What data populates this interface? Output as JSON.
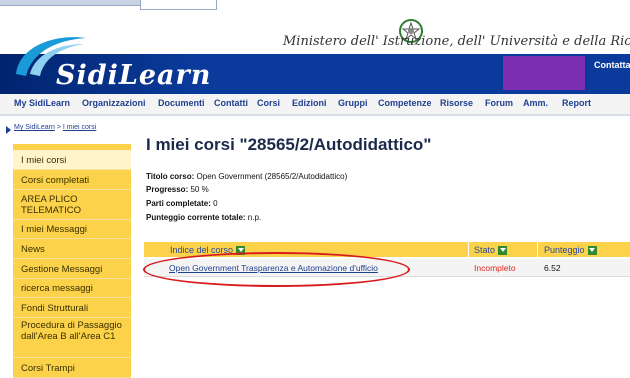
{
  "header": {
    "brand": "SidiLearn",
    "ministry": "Ministero dell' Istruzione, dell' Università e della Ricerca",
    "contact_label": "Contattaci",
    "brand_color": "#0a3b9c",
    "accent_purple": "#7b2fb0"
  },
  "nav": {
    "items": [
      {
        "label": "My SidiLearn"
      },
      {
        "label": "Organizzazioni"
      },
      {
        "label": "Documenti"
      },
      {
        "label": "Contatti"
      },
      {
        "label": "Corsi"
      },
      {
        "label": "Edizioni"
      },
      {
        "label": "Gruppi"
      },
      {
        "label": "Competenze"
      },
      {
        "label": "Risorse"
      },
      {
        "label": "Forum"
      },
      {
        "label": "Amm."
      },
      {
        "label": "Report"
      }
    ]
  },
  "breadcrumb": {
    "home": "My SidiLearn",
    "sep": ">",
    "current": "I miei corsi"
  },
  "sidebar": {
    "items": [
      {
        "label": "I miei corsi"
      },
      {
        "label": "Corsi completati"
      },
      {
        "label": "AREA PLICO TELEMATICO"
      },
      {
        "label": "I miei Messaggi"
      },
      {
        "label": "News"
      },
      {
        "label": "Gestione Messaggi"
      },
      {
        "label": "ricerca messaggi"
      },
      {
        "label": "Fondi Strutturali"
      },
      {
        "label": "Procedura di Passaggio dall'Area B all'Area C1"
      },
      {
        "label": "Corsi Trampi"
      }
    ]
  },
  "main": {
    "title": "I miei corsi \"28565/2/Autodidattico\"",
    "course_title_label": "Titolo corso:",
    "course_title_value": "Open Government (28565/2/Autodidattico)",
    "progress_label": "Progresso:",
    "progress_value": "50 %",
    "parts_label": "Parti completate:",
    "parts_value": "0",
    "score_label": "Punteggio corrente totale:",
    "score_value": "n.p."
  },
  "table": {
    "headers": {
      "index": "Indice del corso",
      "status": "Stato",
      "score": "Punteggio"
    },
    "rows": [
      {
        "index": "Open Government Trasparenza e Automazione d'ufficio",
        "status": "Incompleto",
        "score": "6.52"
      }
    ]
  }
}
